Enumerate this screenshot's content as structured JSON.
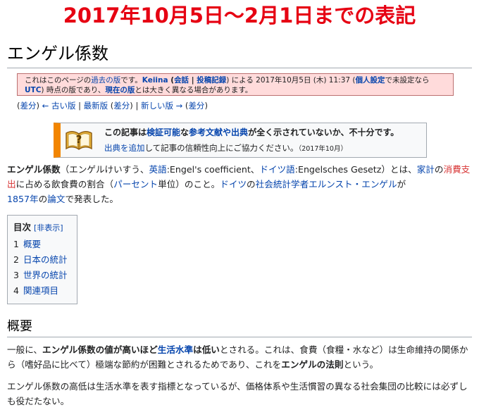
{
  "banner": "2017年10月5日〜2月1日までの表記",
  "page_title": "エンゲル係数",
  "revision_notice": {
    "t1": "これはこのページの",
    "old_version": "過去の版",
    "t2": "です。",
    "user": "Keiina",
    "t3": " (",
    "talk": "会話",
    "sep": " | ",
    "contribs": "投稿記録",
    "t4": ") による 2017年10月5日 (木) 11:37 (",
    "prefs": "個人設定",
    "t5": "で未設定なら",
    "utc": "UTC",
    "t6": ") 時点の版であり、",
    "current": "現在の版",
    "t7": "とは大きく異なる場合があります。"
  },
  "rev_nav": {
    "diff1": "差分",
    "prev": "← 古い版",
    "latest": "最新版",
    "diff2": "差分",
    "next": "新しい版 →",
    "diff3": "差分"
  },
  "ambox": {
    "a": "この記事は",
    "verifiable": "検証可能",
    "b": "な",
    "refs": "参考文献や出典",
    "c": "が全く示されていないか、不十分です。",
    "add_source": "出典を追加",
    "d": "して記事の信頼性向上にご協力ください。",
    "date": "（2017年10月）"
  },
  "intro": {
    "term": "エンゲル係数",
    "t1": "（エンゲルけいすう、",
    "english": "英語",
    "t2": ":Engel's coefficient、",
    "german": "ドイツ語",
    "t3": ":Engelsches Gesetz）とは、",
    "household": "家計",
    "t4": "の",
    "consumption": "消費支出",
    "t5": "に占める飲食費の割合（",
    "percent": "パーセント",
    "t6": "単位）のこと。",
    "germany": "ドイツ",
    "t7": "の",
    "statistician": "社会統計学者",
    "engel": "エルンスト・エンゲル",
    "t8": "が",
    "year": "1857年",
    "t9": "の",
    "paper": "論文",
    "t10": "で発表した。"
  },
  "toc": {
    "title": "目次",
    "hide": "[非表示]",
    "items": [
      {
        "num": "1",
        "label": "概要"
      },
      {
        "num": "2",
        "label": "日本の統計"
      },
      {
        "num": "3",
        "label": "世界の統計"
      },
      {
        "num": "4",
        "label": "関連項目"
      }
    ]
  },
  "section": {
    "heading": "概要",
    "p1": {
      "t1": "一般に、",
      "b1": "エンゲル係数の値が高いほど",
      "link": "生活水準",
      "b2": "は低い",
      "t2": "とされる。これは、食費（食糧・水など）は生命維持の関係から（嗜好品に比べて）極端な節約が困難とされるためであり、これを",
      "b3": "エンゲルの法則",
      "t3": "という。"
    },
    "p2": "エンゲル係数の高低は生活水準を表す指標となっているが、価格体系や生活慣習の異なる社会集団の比較には必ずしも役だたない。"
  }
}
